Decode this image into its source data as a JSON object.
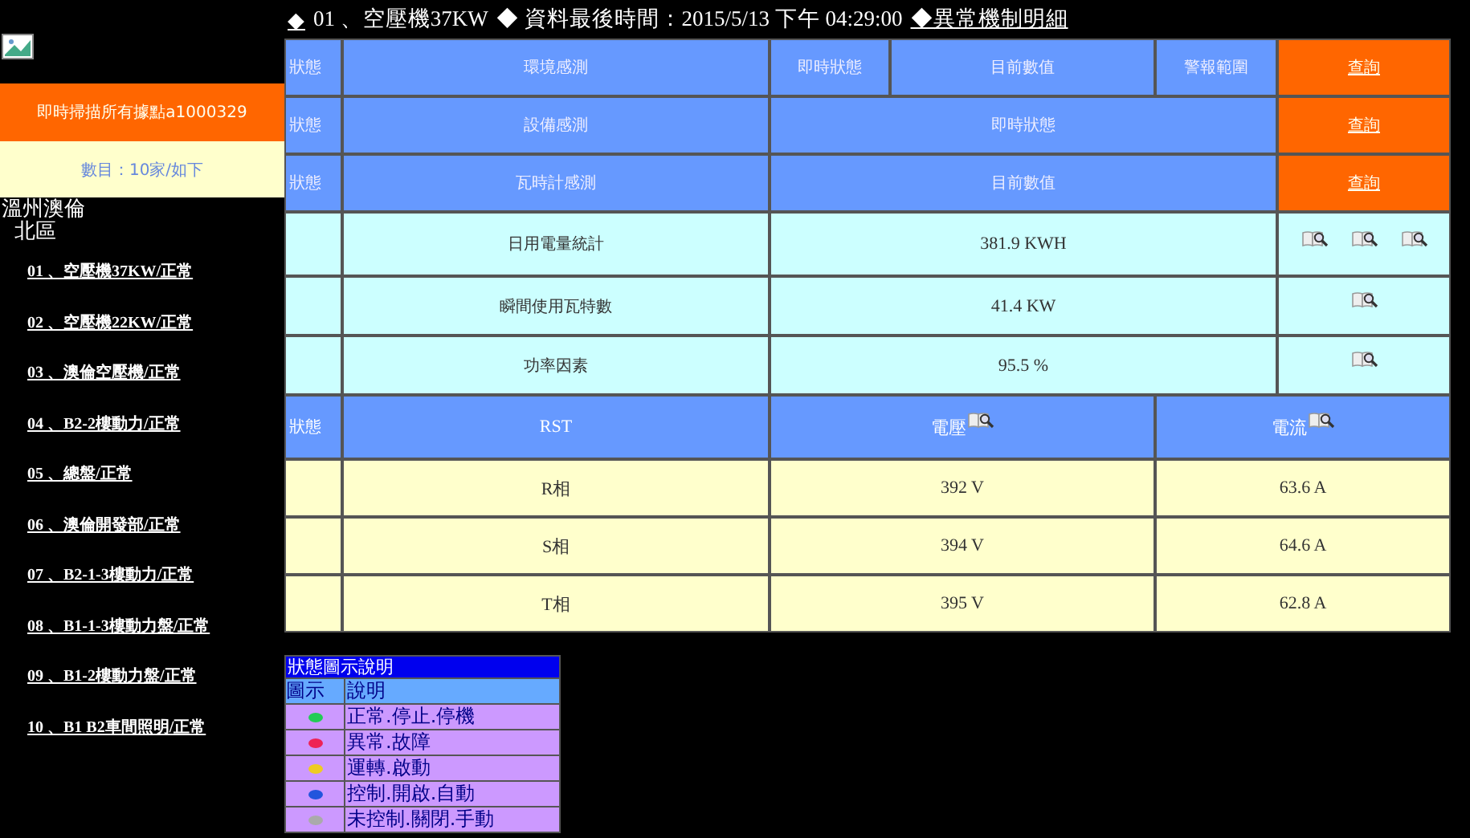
{
  "header": [
    {
      "text": "◆",
      "kind": "link"
    },
    {
      "text": "01 、空壓機37KW",
      "kind": "text"
    },
    {
      "text": "◆ 資料最後時間：2015/5/13 下午 04:29:00",
      "kind": "text"
    },
    {
      "text": "◆異常機制明細",
      "kind": "link"
    }
  ],
  "sidebar": {
    "scan_button": "即時掃描所有據點a1000329",
    "count": "數目：10家/如下",
    "company": "溫州澳倫",
    "region": "北區",
    "items": [
      "01 、空壓機37KW/正常",
      "02 、空壓機22KW/正常",
      "03 、澳倫空壓機/正常",
      "04 、B2-2樓動力/正常",
      "05 、總盤/正常",
      "06 、澳倫開發部/正常",
      "07 、B2-1-3樓動力/正常",
      "08 、B1-1-3樓動力盤/正常",
      "09 、B1-2樓動力盤/正常",
      "10 、B1 B2車間照明/正常"
    ]
  },
  "sections": [
    {
      "status": "狀態",
      "label": "環境感測",
      "columns": [
        "即時狀態",
        "目前數值",
        "警報範圍"
      ],
      "action": "查詢"
    },
    {
      "status": "狀態",
      "label": "設備感測",
      "columns": [
        "即時狀態"
      ],
      "action": "查詢"
    },
    {
      "status": "狀態",
      "label": "瓦時計感測",
      "columns": [
        "目前數值"
      ],
      "action": "查詢"
    }
  ],
  "meters": [
    {
      "label": "日用電量統計",
      "value": "381.9 KWH",
      "lookups": [
        {
          "kind": "lookup"
        },
        {
          "kind": "lookup"
        },
        {
          "kind": "lookup"
        }
      ]
    },
    {
      "label": "瞬間使用瓦特數",
      "value": "41.4 KW",
      "lookups": [
        {
          "kind": "lookup"
        }
      ]
    },
    {
      "label": "功率因素",
      "value": "95.5 %",
      "lookups": [
        {
          "kind": "lookup"
        }
      ]
    }
  ],
  "phases": {
    "status": "狀態",
    "columns": [
      {
        "label": "RST",
        "kind": "plain"
      },
      {
        "label": "電壓",
        "kind": "lookup"
      },
      {
        "label": "電流",
        "kind": "lookup"
      }
    ],
    "rows": [
      [
        "R相",
        "392 V",
        "63.6 A"
      ],
      [
        "S相",
        "394 V",
        "64.6 A"
      ],
      [
        "T相",
        "395 V",
        "62.8 A"
      ]
    ]
  },
  "legend": {
    "title": "狀態圖示說明",
    "columns": [
      "圖示",
      "說明"
    ],
    "rows": [
      {
        "color": "#22cc55",
        "text": "正常.停止.停機"
      },
      {
        "color": "#ee2255",
        "text": "異常.故障"
      },
      {
        "color": "#eecc22",
        "text": "運轉.啟動"
      },
      {
        "color": "#2255dd",
        "text": "控制.開啟.自動"
      },
      {
        "color": "#aaaaaa",
        "text": "未控制.關閉.手動"
      }
    ]
  }
}
